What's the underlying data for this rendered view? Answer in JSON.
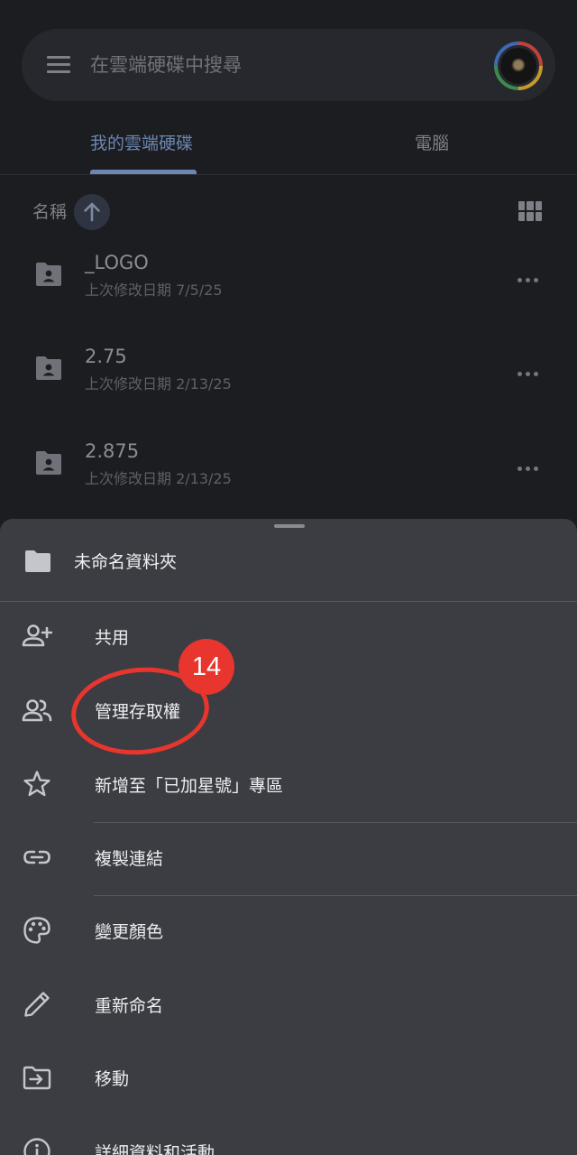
{
  "search": {
    "placeholder": "在雲端硬碟中搜尋"
  },
  "tabs": [
    {
      "label": "我的雲端硬碟",
      "active": true
    },
    {
      "label": "電腦",
      "active": false
    }
  ],
  "sort": {
    "label": "名稱",
    "direction": "ascending"
  },
  "files": [
    {
      "name": "_LOGO",
      "modified": "上次修改日期 7/5/25"
    },
    {
      "name": "2.75",
      "modified": "上次修改日期 2/13/25"
    },
    {
      "name": "2.875",
      "modified": "上次修改日期 2/13/25"
    }
  ],
  "sheet": {
    "title": "未命名資料夾",
    "items": [
      {
        "label": "共用",
        "icon": "person-add-icon"
      },
      {
        "label": "管理存取權",
        "icon": "people-icon"
      },
      {
        "label": "新增至「已加星號」專區",
        "icon": "star-icon"
      },
      {
        "label": "複製連結",
        "icon": "link-icon"
      },
      {
        "label": "變更顏色",
        "icon": "palette-icon"
      },
      {
        "label": "重新命名",
        "icon": "pencil-icon"
      },
      {
        "label": "移動",
        "icon": "move-folder-icon"
      },
      {
        "label": "詳細資料和活動",
        "icon": "info-icon"
      }
    ]
  },
  "annotation": {
    "step": "14"
  },
  "colors": {
    "accent": "#6c86b1",
    "sheet_bg": "#3c3d42",
    "annotation_red": "#e8352d"
  }
}
